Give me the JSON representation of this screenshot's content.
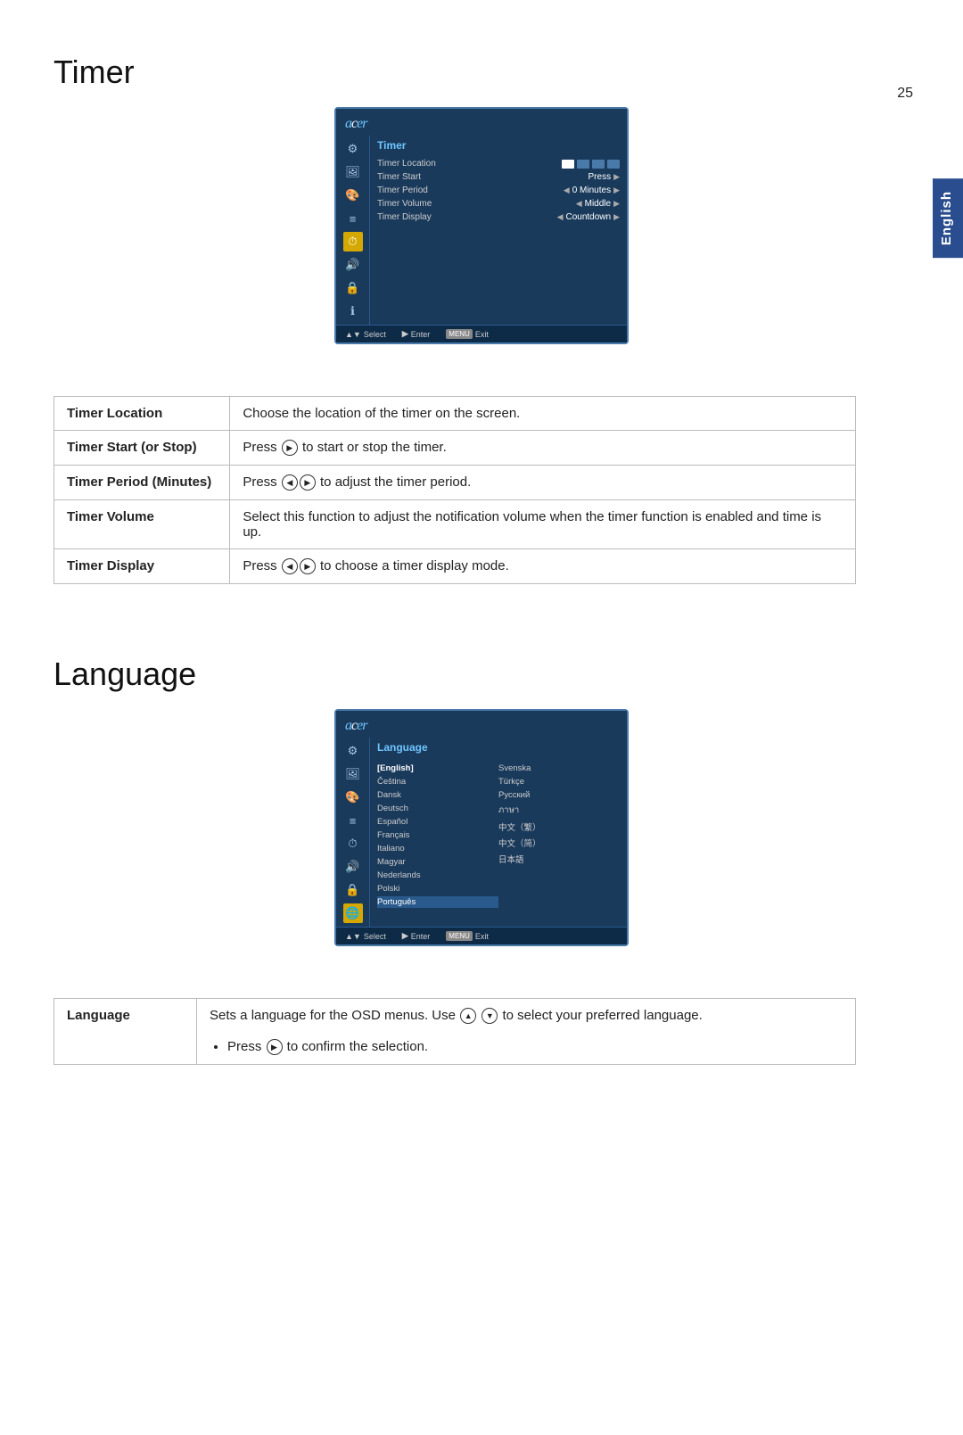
{
  "page": {
    "number": "25",
    "english_tab": "English"
  },
  "timer_section": {
    "title": "Timer",
    "osd": {
      "logo": "acer",
      "section": "Timer",
      "rows": [
        {
          "label": "Timer Location",
          "value": "",
          "icons": true
        },
        {
          "label": "Timer Start",
          "value": "Press",
          "has_right_arrow": true
        },
        {
          "label": "Timer Period",
          "value": "0 Minutes",
          "has_left_arrow": true,
          "has_right_arrow": true
        },
        {
          "label": "Timer Volume",
          "value": "Middle",
          "has_left_arrow": true,
          "has_right_arrow": true
        },
        {
          "label": "Timer Display",
          "value": "Countdown",
          "has_left_arrow": true,
          "has_right_arrow": true
        }
      ],
      "footer": [
        {
          "key": "▲▼",
          "label": "Select"
        },
        {
          "key": "▶",
          "label": "Enter"
        },
        {
          "key": "MENU",
          "label": "Exit"
        }
      ]
    },
    "table": [
      {
        "term": "Timer Location",
        "description": "Choose the location of the timer on the screen."
      },
      {
        "term": "Timer Start (or Stop)",
        "description": "Press ▶ to start or stop the timer."
      },
      {
        "term": "Timer Period (Minutes)",
        "description": "Press ◀▶ to adjust the timer period."
      },
      {
        "term": "Timer Volume",
        "description": "Select this function to adjust the notification volume when the timer function is enabled and time is up."
      },
      {
        "term": "Timer Display",
        "description": "Press ◀▶ to choose a timer display mode."
      }
    ]
  },
  "language_section": {
    "title": "Language",
    "osd": {
      "logo": "acer",
      "section": "Language",
      "col1": [
        "[English]",
        "Čeština",
        "Dansk",
        "Deutsch",
        "Español",
        "Français",
        "Italiano",
        "Magyar",
        "Nederlands",
        "Polski",
        "Português"
      ],
      "col2": [
        "Svenska",
        "Türkçe",
        "Русский",
        "ภาษา",
        "中文（繁）",
        "中文（简）",
        "日本語"
      ]
    },
    "table": [
      {
        "term": "Language",
        "description": "Sets a language for the OSD menus. Use ▲ ▼ to select your preferred language.",
        "bullet": "Press ▶ to confirm the selection."
      }
    ]
  }
}
